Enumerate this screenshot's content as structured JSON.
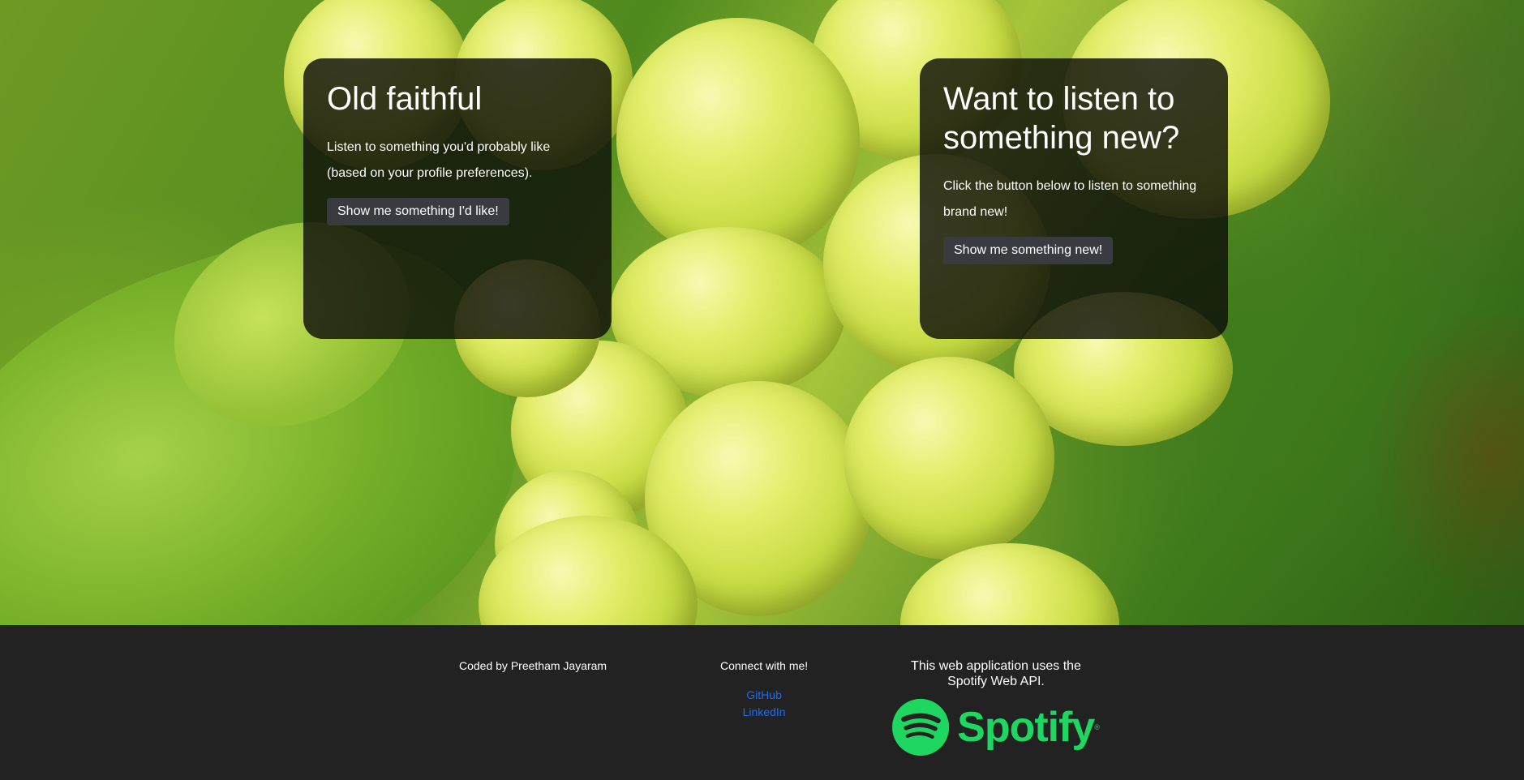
{
  "cards": {
    "left": {
      "title": "Old faithful",
      "body": "Listen to something you'd probably like (based on your profile preferences).",
      "button": "Show me something I'd like!"
    },
    "right": {
      "title": "Want to listen to something new?",
      "body": "Click the button below to listen to something brand new!",
      "button": "Show me something new!"
    }
  },
  "footer": {
    "credit": "Coded by Preetham Jayaram",
    "connect_heading": "Connect with me!",
    "links": [
      "GitHub",
      "LinkedIn"
    ],
    "api_note": "This web application uses the Spotify Web API.",
    "spotify_wordmark": "Spotify",
    "registered_mark": "®"
  },
  "colors": {
    "footer_bg": "#222222",
    "link": "#1e6cf0",
    "spotify_green": "#1ed760",
    "button_bg": "#3a3b40"
  },
  "icons": [
    "spotify-icon"
  ]
}
